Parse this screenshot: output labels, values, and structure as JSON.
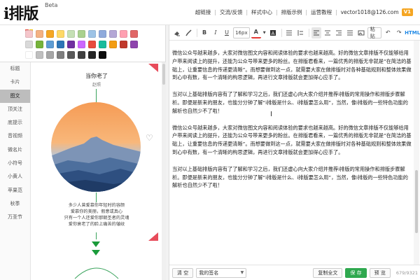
{
  "header": {
    "logo": "i排版",
    "logo_badge": "Beta",
    "nav": [
      {
        "label": "超链接"
      },
      {
        "label": "交流/反馈"
      },
      {
        "label": "样式中心"
      },
      {
        "label": "排版示例"
      },
      {
        "label": "运营教程"
      }
    ],
    "user_email": "vector1018@126.com",
    "vip_badge": "V1"
  },
  "palette": {
    "row1": [
      "#f5c6cb",
      "#f4b183",
      "#f5a623",
      "#ffd966",
      "#c5e0b4",
      "#a9d18e",
      "#9dc3e6",
      "#8faadc",
      "#b4a7d6",
      "#ff9fb1",
      "#e06666"
    ],
    "row2": [
      "#d9d9d9",
      "#76b33b",
      "#5e9cd3",
      "#2e75b6",
      "#7030a0",
      "#cc66ff",
      "#e84c3d",
      "#1abc9c",
      "#f39c12",
      "#c0392b",
      "#8e44ad"
    ],
    "row3": [
      "#ffffff",
      "#bfbfbf",
      "#a6a6a6",
      "#7f7f7f",
      "#595959",
      "#404040",
      "#262626",
      "#0d0d0d"
    ]
  },
  "categories": [
    {
      "label": "标题",
      "active": false
    },
    {
      "label": "卡片",
      "active": false
    },
    {
      "label": "图文",
      "active": true
    },
    {
      "label": "顶关注",
      "active": false
    },
    {
      "label": "底提示",
      "active": false
    },
    {
      "label": "音视频",
      "active": false
    },
    {
      "label": "微名片",
      "active": false
    },
    {
      "label": "小符号",
      "active": false
    },
    {
      "label": "小黄人",
      "active": false
    },
    {
      "label": "苹果范",
      "active": false
    },
    {
      "label": "秋季",
      "active": false
    },
    {
      "label": "万圣节",
      "active": false
    }
  ],
  "template": {
    "title": "当你老了",
    "author": "赵照",
    "poem": [
      "多少人曾爱慕你年轻时的容颜",
      "爱慕你的美丽，假意或真心",
      "只有一个人还爱你那朝圣者的灵魂",
      "爱你衰老了的脸上痛苦的皱纹"
    ],
    "heart_icon": "heart-icon"
  },
  "toolbar": {
    "font_size": "16px",
    "icons": [
      "eraser-icon",
      "brush-icon",
      "bold-icon",
      "italic-icon",
      "underline-icon",
      "font-color-icon",
      "bg-color-icon",
      "list-icon",
      "line-height-icon",
      "align-left-icon",
      "align-center-icon",
      "align-right-icon",
      "align-justify-icon",
      "image-icon",
      "undo-icon",
      "redo-icon"
    ],
    "paste_label": "粘贴",
    "html_label": "HTML"
  },
  "editor": {
    "paragraphs": [
      "微信公众号越来越多，大家对微信图文内容和阅读体验的要求也越来越高。好的微信文章排版不仅能够给用户带来阅读上的提升，还能为公众号带来更多的粉丝。在排版君看来，一篇优秀的排版无非就是“在简洁的基础上，让重要信息的传递更清晰”。而想要做到这一点，就需要大家在做排版时对各种基础规则和整体效果做到心中有数，有一个清晰的构思逻辑，再进行文章排版就会更加得心应手了。",
      "当对以上基础排版内容有了了解和学习之后，我们还虚心向大家介绍并推荐i排版的常用操作和排版步骤解析。即便是新来的朋友，也能分分钟了解“i排版是什么、i排版要怎么用”，当然，像i排版的一些特色功能的解析也自然少不了啦！",
      "微信公众号越来越多，大家对微信图文内容和阅读体验的要求也越来越高。好的微信文章排版不仅能够给用户带来阅读上的提升，还能为公众号带来更多的粉丝。在排版君看来，一篇优秀的排版无非就是“在简洁的基础上，让重要信息的传递更清晰”。而想要做到这一点，就需要大家在做排版时对各种基础规则和整体效果做到心中有数，有一个清晰的构思逻辑，再进行文章排版就会更加得心应手了。",
      "当对以上基础排版内容有了了解和学习之后，我们还虚心向大家介绍并推荐i排版的常用操作和排版步骤解析。即便是新来的朋友，也能分分钟了解“i排版是什么、i排版要怎么用”，当然，像i排版的一些特色功能的解析也自然少不了啦！"
    ]
  },
  "bottom": {
    "clear_label": "清 空",
    "signature_value": "我的签名",
    "copy_label": "复制全文",
    "save_label": "保 存",
    "preview_label": "预 览",
    "counter": "679/9321"
  },
  "colors": {
    "accent_green": "#2fa84f",
    "corner_red": "#e74c5b",
    "html_blue": "#1e88e5"
  }
}
